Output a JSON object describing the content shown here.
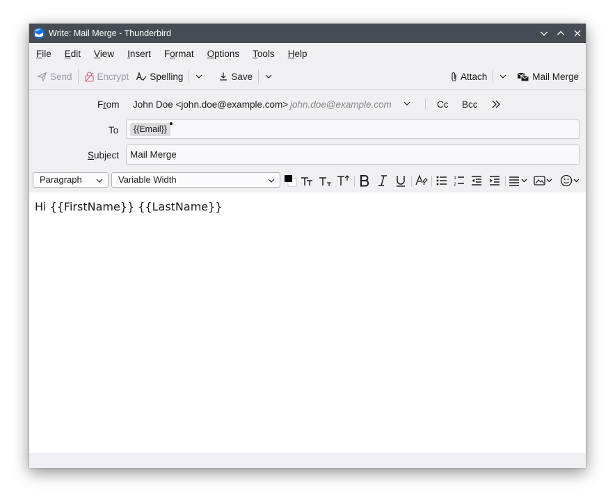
{
  "window": {
    "title": "Write: Mail Merge - Thunderbird"
  },
  "menu": {
    "file": {
      "pre": "",
      "key": "F",
      "post": "ile"
    },
    "edit": {
      "pre": "",
      "key": "E",
      "post": "dit"
    },
    "view": {
      "pre": "",
      "key": "V",
      "post": "iew"
    },
    "insert": {
      "pre": "",
      "key": "I",
      "post": "nsert"
    },
    "format": {
      "pre": "F",
      "key": "o",
      "post": "rmat"
    },
    "options": {
      "pre": "",
      "key": "O",
      "post": "ptions"
    },
    "tools": {
      "pre": "",
      "key": "T",
      "post": "ools"
    },
    "help": {
      "pre": "",
      "key": "H",
      "post": "elp"
    }
  },
  "toolbar": {
    "send": "Send",
    "encrypt": "Encrypt",
    "spelling": "Spelling",
    "save": "Save",
    "attach": "Attach",
    "mail_merge": "Mail Merge"
  },
  "headers": {
    "from_label": {
      "pre": "F",
      "key": "r",
      "post": "om"
    },
    "from_value": "John Doe <john.doe@example.com>",
    "from_placeholder": "john.doe@example.com",
    "cc": "Cc",
    "bcc": "Bcc",
    "to_label": "To",
    "to_recipient": "{{Email}}",
    "subject_label": {
      "pre": "",
      "key": "S",
      "post": "ubject"
    },
    "subject_value": "Mail Merge"
  },
  "format_bar": {
    "paragraph_select": "Paragraph",
    "font_select": "Variable Width"
  },
  "editor": {
    "body_text": "Hi {{FirstName}} {{LastName}}"
  },
  "colors": {
    "titlebar_bg": "#474c54",
    "chrome_bg": "#f0f0f4",
    "pill_bg": "#dcdce0"
  },
  "icons": [
    "thunderbird-logo-icon",
    "minimize-icon",
    "maximize-icon",
    "close-icon",
    "send-icon",
    "encrypt-icon",
    "spelling-icon",
    "save-icon",
    "paperclip-icon",
    "mail-merge-icon",
    "more-fields-icon",
    "text-color-icon",
    "smaller-text-icon",
    "subscript-icon",
    "superscript-icon",
    "bold-icon",
    "italic-icon",
    "underline-icon",
    "remove-formatting-icon",
    "bulleted-list-icon",
    "numbered-list-icon",
    "outdent-icon",
    "indent-icon",
    "align-icon",
    "insert-image-icon",
    "emoji-icon"
  ]
}
